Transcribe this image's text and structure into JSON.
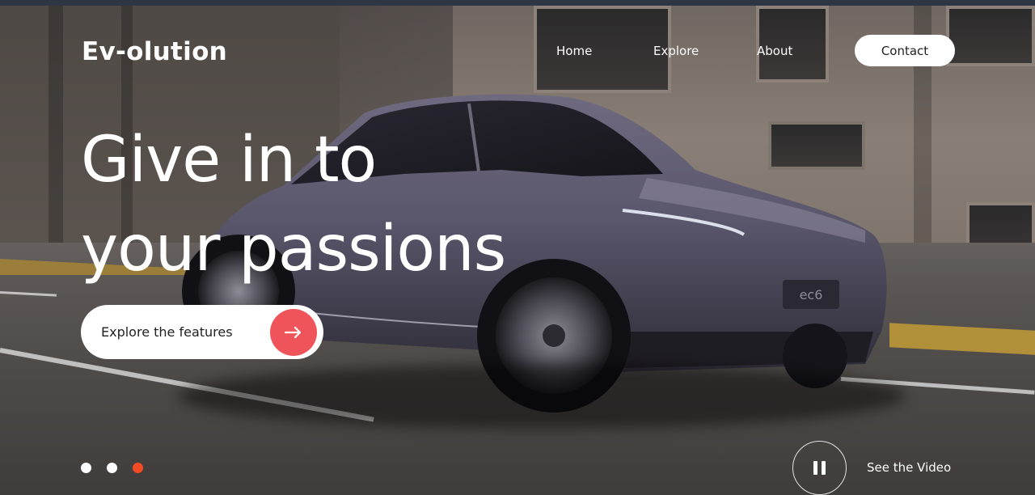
{
  "brand": {
    "logo_text": "Ev-olution"
  },
  "nav": {
    "items": [
      {
        "label": "Home"
      },
      {
        "label": "Explore"
      },
      {
        "label": "About"
      }
    ],
    "contact_label": "Contact"
  },
  "hero": {
    "headline_line1": "Give in to",
    "headline_line2": "your passions",
    "cta_label": "Explore the features",
    "cta_icon": "arrow-right-icon",
    "car_plate": "ec6"
  },
  "carousel": {
    "total": 3,
    "active_index": 2
  },
  "video": {
    "label": "See the Video",
    "state_icon": "pause-icon"
  },
  "colors": {
    "accent": "#f0545b",
    "active_dot": "#f24a22",
    "text": "#ffffff",
    "button_bg": "#ffffff",
    "top_bar": "#2e3645"
  }
}
